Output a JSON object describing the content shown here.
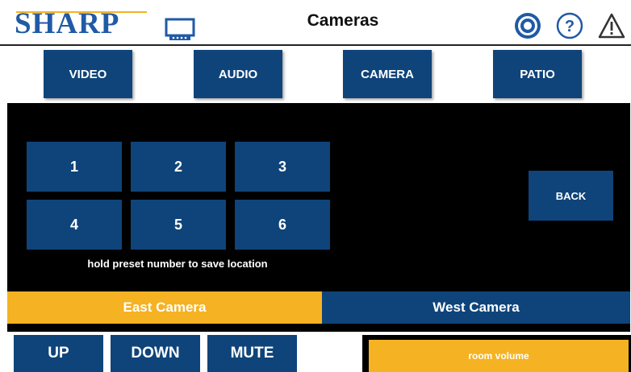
{
  "header": {
    "logo_text": "SHARP",
    "title": "Cameras",
    "icons": [
      "display-icon",
      "power-icon",
      "help-icon",
      "warning-icon"
    ],
    "accent_color": "#f5b222",
    "power_color": "#1f5aa6"
  },
  "nav": {
    "video": "VIDEO",
    "audio": "AUDIO",
    "camera": "CAMERA",
    "patio": "PATIO"
  },
  "presets": [
    "1",
    "2",
    "3",
    "4",
    "5",
    "6"
  ],
  "back_label": "BACK",
  "hint": "hold preset number to save location",
  "cameras": {
    "east": "East Camera",
    "west": "West Camera",
    "selected": "East Camera",
    "selected_color": "#f5b222",
    "unselected_color": "#0f447a"
  },
  "controls": {
    "up": "UP",
    "down": "DOWN",
    "mute": "MUTE",
    "volume": "room volume"
  }
}
